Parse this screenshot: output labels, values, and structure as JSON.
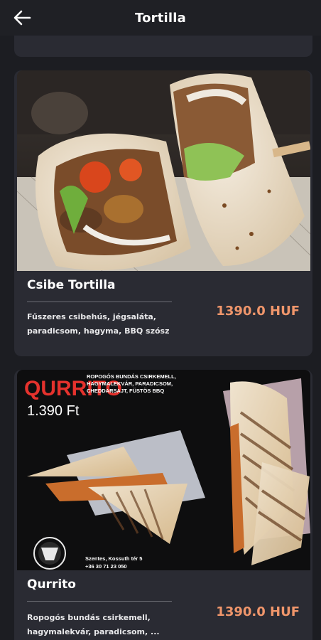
{
  "appbar": {
    "title": "Tortilla",
    "back_icon": "arrow-left-icon"
  },
  "items": [
    {
      "name": "Csibe Tortilla",
      "description": "Fűszeres csibehús, jégsaláta, paradicsom, hagyma, BBQ szósz",
      "price": "1390.0 HUF"
    },
    {
      "name": "Qurrito",
      "description": "Ropogós bundás csirkemell, hagymalekvár, paradicsom, ...",
      "price": "1390.0 HUF",
      "photo_text": {
        "brand": "QURRITO",
        "tagline_1": "ROPOGÓS BUNDÁS CSIRKEMELL,",
        "tagline_2": "HAGYMALEKVÁR, PARADICSOM,",
        "tagline_3": "CHEDDARSAJT, FÜSTÖS BBQ",
        "price": "1.390 Ft",
        "address": "Szentes, Kossuth tér 5",
        "phone": "+36 30 71 23 050"
      }
    }
  ],
  "colors": {
    "background": "#1c1d22",
    "card": "#2a2b33",
    "price": "#f0966b",
    "brand_red": "#e5322d"
  }
}
